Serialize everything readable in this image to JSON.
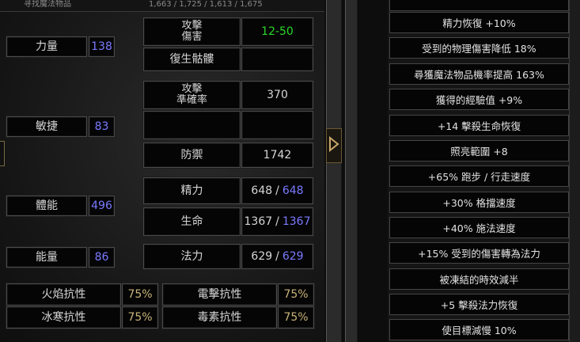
{
  "top_strip": {
    "left_text": "寻找魔法物品",
    "right_text": "1,663 / 1,725 / 1,613 / 1,675"
  },
  "attributes": [
    {
      "label": "力量",
      "value": "138"
    },
    {
      "label": "敏捷",
      "value": "83"
    },
    {
      "label": "體能",
      "value": "496"
    },
    {
      "label": "能量",
      "value": "86"
    }
  ],
  "stats": {
    "damage": {
      "label": "攻擊\n傷害",
      "value": "12-50"
    },
    "revive": {
      "label": "復生骷髏",
      "value": ""
    },
    "attack_rating": {
      "label": "攻擊\n準確率",
      "value": "370"
    },
    "empty_row": {
      "label": "",
      "value": ""
    },
    "defense": {
      "label": "防禦",
      "value": "1742"
    },
    "stamina": {
      "label": "精力",
      "current": "648",
      "max": "648"
    },
    "life": {
      "label": "生命",
      "current": "1367",
      "max": "1367"
    },
    "mana": {
      "label": "法力",
      "current": "629",
      "max": "629"
    }
  },
  "resistances": [
    {
      "label": "火焰抗性",
      "value": "75%"
    },
    {
      "label": "電擊抗性",
      "value": "75%"
    },
    {
      "label": "冰寒抗性",
      "value": "75%"
    },
    {
      "label": "毒素抗性",
      "value": "75%"
    }
  ],
  "properties": [
    "精力恢復 +10%",
    "受到的物理傷害降低 18%",
    "尋獲魔法物品機率提高 163%",
    "獲得的經驗值 +9%",
    "+14 擊殺生命恢復",
    "照亮範圍 +8",
    "+65% 跑步 / 行走速度",
    "+30% 格擋速度",
    "+40% 施法速度",
    "+15% 受到的傷害轉為法力",
    "被凍結的時效減半",
    "+5 擊殺法力恢復",
    "使目標減慢 10%"
  ],
  "icons": {
    "expand_arrow": "arrow-right-icon"
  },
  "colors": {
    "blue_value": "#7a7aff",
    "green_value": "#28d928",
    "gold_value": "#c9b37a"
  }
}
